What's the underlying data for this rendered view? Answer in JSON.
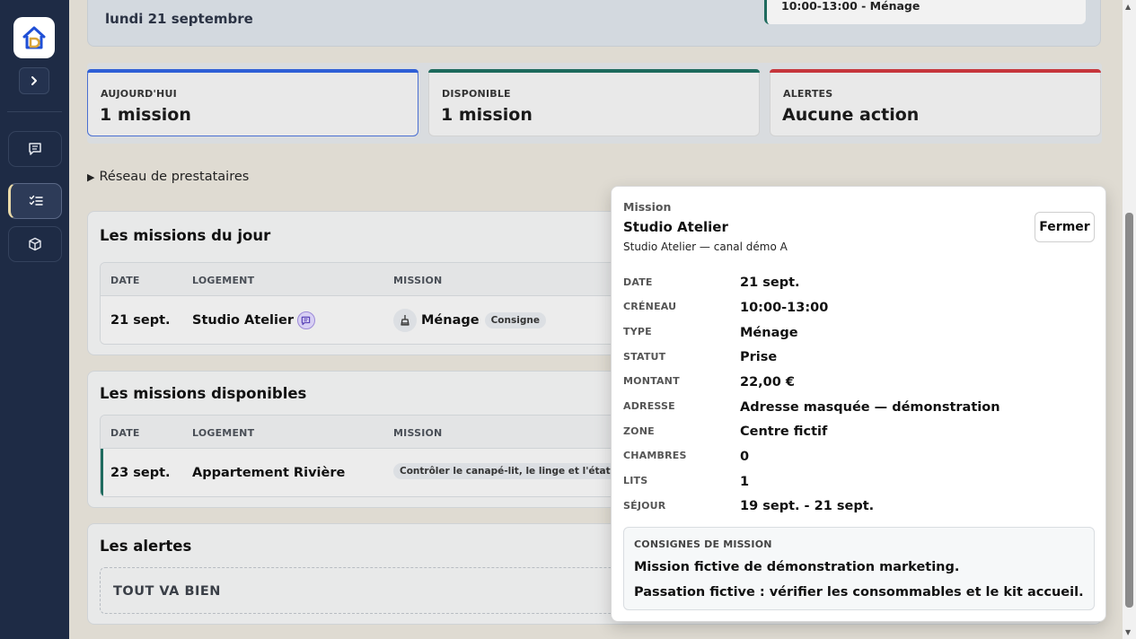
{
  "sidebar": {
    "items": [
      {
        "icon": "message-icon"
      },
      {
        "icon": "checklist-icon",
        "active": true
      },
      {
        "icon": "cube-icon"
      }
    ]
  },
  "header": {
    "date": "lundi 21 septembre",
    "next_slot": "10:00-13:00 - Ménage"
  },
  "stats": [
    {
      "label": "AUJOURD'HUI",
      "value": "1 mission",
      "color": "#2f5fd6"
    },
    {
      "label": "DISPONIBLE",
      "value": "1 mission",
      "color": "#1e6b5d"
    },
    {
      "label": "ALERTES",
      "value": "Aucune action",
      "color": "#c6363c"
    }
  ],
  "network": {
    "label": "Réseau de prestataires"
  },
  "today": {
    "title": "Les missions du jour",
    "columns": {
      "date": "DATE",
      "logement": "LOGEMENT",
      "mission": "MISSION"
    },
    "row": {
      "date": "21 sept.",
      "logement": "Studio Atelier",
      "mission": "Ménage",
      "tag": "Consigne"
    }
  },
  "available": {
    "title": "Les missions disponibles",
    "columns": {
      "date": "DATE",
      "logement": "LOGEMENT",
      "mission": "MISSION"
    },
    "row": {
      "date": "23 sept.",
      "logement": "Appartement Rivière",
      "tag": "Contrôler le canapé-lit, le linge et l'état de la"
    }
  },
  "alerts": {
    "title": "Les alertes",
    "status": "TOUT VA BIEN"
  },
  "popover": {
    "kicker": "Mission",
    "title": "Studio Atelier",
    "subtitle": "Studio Atelier — canal démo A",
    "close_label": "Fermer",
    "fields": [
      {
        "key": "DATE",
        "value": "21 sept."
      },
      {
        "key": "CRÉNEAU",
        "value": "10:00-13:00"
      },
      {
        "key": "TYPE",
        "value": "Ménage"
      },
      {
        "key": "STATUT",
        "value": "Prise"
      },
      {
        "key": "MONTANT",
        "value": "22,00 €"
      },
      {
        "key": "ADRESSE",
        "value": "Adresse masquée — démonstration"
      },
      {
        "key": "ZONE",
        "value": "Centre fictif"
      },
      {
        "key": "CHAMBRES",
        "value": "0"
      },
      {
        "key": "LITS",
        "value": "1"
      },
      {
        "key": "SÉJOUR",
        "value": "19 sept. - 21 sept."
      }
    ],
    "notes": {
      "heading": "CONSIGNES DE MISSION",
      "line1": "Mission fictive de démonstration marketing.",
      "line2": "Passation fictive : vérifier les consommables et le kit accueil."
    }
  }
}
